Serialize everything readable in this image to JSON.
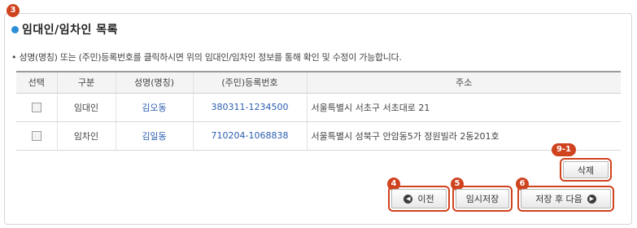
{
  "section": {
    "badge": "3",
    "title": "임대인/임차인 목록",
    "notice": "• 성명(명칭) 또는 (주민)등록번호를 클릭하시면 위의 임대인/임차인 정보를 통해 확인 및 수정이 가능합니다."
  },
  "table": {
    "headers": [
      "선택",
      "구분",
      "성명(명칭)",
      "(주민)등록번호",
      "주소"
    ],
    "rows": [
      {
        "type": "임대인",
        "name": "김오동",
        "reg_no": "380311-1234500",
        "address": "서울특별시 서초구 서초대로 21"
      },
      {
        "type": "임차인",
        "name": "김일동",
        "reg_no": "710204-1068838",
        "address": "서울특별시 성북구 안암동5가 정원빌라 2동201호"
      }
    ]
  },
  "buttons": {
    "delete": {
      "label": "삭제",
      "badge": "9-1"
    },
    "prev": {
      "label": "이전",
      "badge": "4"
    },
    "temp_save": {
      "label": "임시저장",
      "badge": "5"
    },
    "save_next": {
      "label": "저장 후 다음",
      "badge": "6"
    }
  },
  "colors": {
    "badge": "#d0431f",
    "link": "#2a5db0",
    "title_dot": "#2c8ed6"
  },
  "icons": {
    "prev": "circle-left-arrow-icon",
    "next": "circle-right-arrow-icon"
  }
}
